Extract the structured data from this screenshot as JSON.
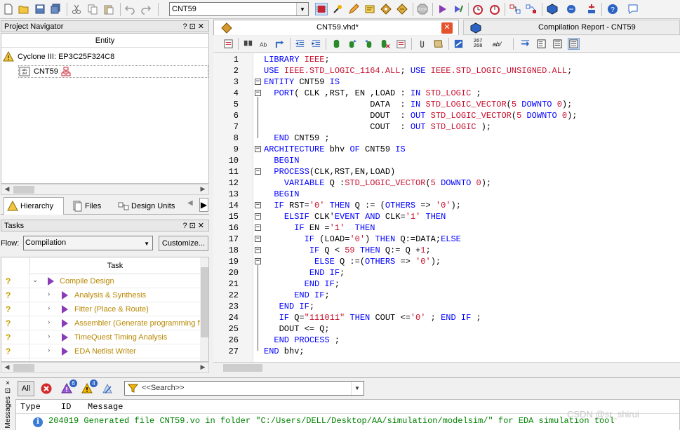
{
  "toolbar": {
    "entity_value": "CNT59",
    "stop_label": "STOP"
  },
  "project_navigator": {
    "title": "Project Navigator",
    "column": "Entity",
    "device": "Cyclone III: EP3C25F324C8",
    "entity": "CNT59",
    "tabs": [
      "Hierarchy",
      "Files",
      "Design Units"
    ]
  },
  "tasks": {
    "title": "Tasks",
    "flow_label": "Flow:",
    "flow_value": "Compilation",
    "customize_label": "Customize...",
    "column": "Task",
    "items": [
      "Compile Design",
      "Analysis & Synthesis",
      "Fitter (Place & Route)",
      "Assembler (Generate programming fil",
      "TimeQuest Timing Analysis",
      "EDA Netlist Writer"
    ]
  },
  "editor": {
    "tabs": [
      "CNT59.vhd*",
      "Compilation Report - CNT59"
    ],
    "toolbar_numbers": [
      "267",
      "268"
    ],
    "toolbar_ab": "ab/",
    "line_numbers": [
      "1",
      "2",
      "3",
      "4",
      "5",
      "6",
      "7",
      "8",
      "9",
      "10",
      "11",
      "12",
      "13",
      "14",
      "15",
      "16",
      "17",
      "18",
      "19",
      "20",
      "21",
      "22",
      "23",
      "24",
      "25",
      "26",
      "27"
    ]
  },
  "messages": {
    "all_label": "All",
    "badge_a": "6",
    "badge_b": "4",
    "search_placeholder": "<<Search>>",
    "columns": [
      "Type",
      "ID",
      "Message"
    ],
    "row_id": "204019",
    "row_text": "Generated file CNT59.vo in folder \"C:/Users/DELL/Desktop/AA/simulation/modelsim/\" for EDA simulation tool",
    "side_labels": [
      "×",
      "⊡",
      "Messages"
    ]
  },
  "watermark": "CSDN @sr_shirui",
  "colors": {
    "keyword": "#0000ff",
    "string": "#c8102e",
    "task_text": "#b88700",
    "message_green": "#008000"
  }
}
